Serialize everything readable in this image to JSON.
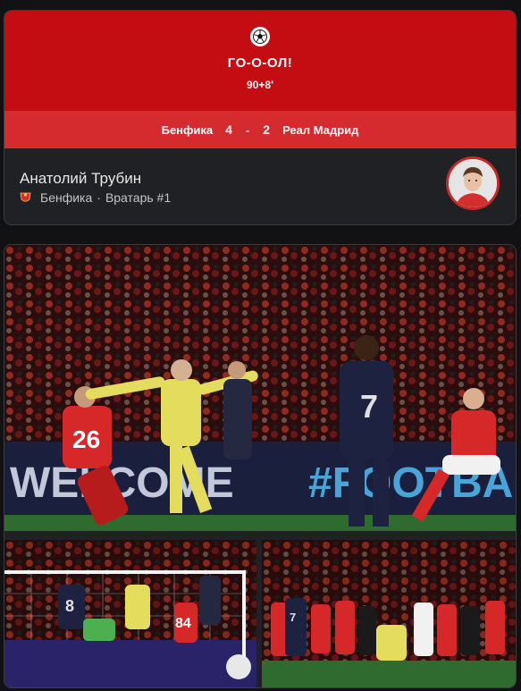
{
  "goal_card": {
    "title": "ГО-О-ОЛ!",
    "minute": "90+8'",
    "icon": "soccer-ball-icon",
    "home_team": "Бенфика",
    "home_score": "4",
    "separator": "-",
    "away_score": "2",
    "away_team": "Реал Мадрид",
    "colors": {
      "header": "#c40d12",
      "score_bar": "#d52b2e"
    }
  },
  "player": {
    "name": "Анатолий Трубин",
    "club": "Бенфика",
    "dot": "·",
    "position": "Вратарь #1",
    "club_icon": "benfica-crest-icon"
  },
  "gallery": {
    "photos": [
      {
        "name": "celebration-photo-main",
        "banner_left": "WELCOME",
        "banner_right": "#FOOTBA",
        "shirt_numbers": [
          "26",
          "7"
        ]
      },
      {
        "name": "goal-photo",
        "shirt_numbers": [
          "8",
          "84"
        ]
      },
      {
        "name": "team-celebration-photo",
        "shirt_numbers": [
          "7"
        ]
      }
    ]
  }
}
